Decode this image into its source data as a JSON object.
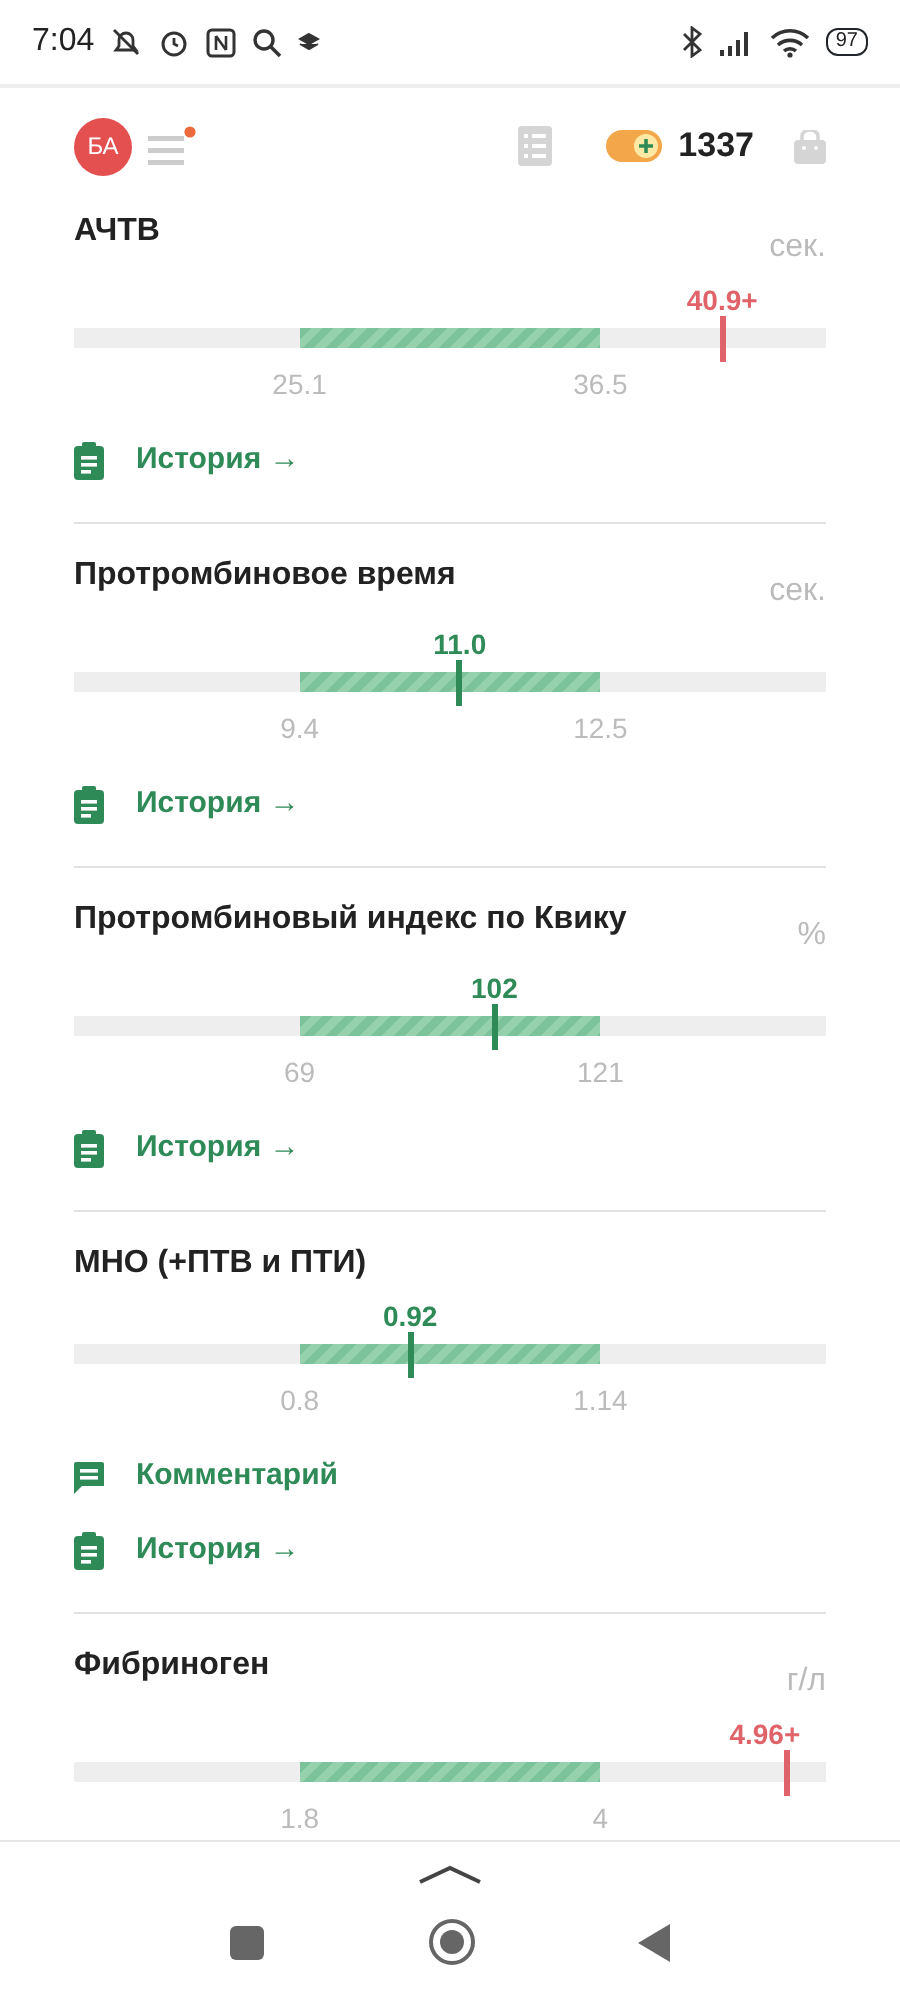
{
  "status_bar": {
    "time": "7:04",
    "battery": "97"
  },
  "header": {
    "avatar": "БА",
    "menu_notification": true,
    "points": "1337"
  },
  "tests": [
    {
      "name": "АЧТВ",
      "unit": "сек.",
      "range": {
        "low": "25.1",
        "high": "36.5"
      },
      "result": {
        "value": "40.9+",
        "level": 0.862,
        "color": "#e0636a"
      },
      "actions": [
        {
          "kind": "history",
          "label": "История →"
        }
      ]
    },
    {
      "name": "Протромбиновое время",
      "unit": "сек.",
      "range": {
        "low": "9.4",
        "high": "12.5"
      },
      "result": {
        "value": "11.0",
        "level": 0.513,
        "color": "#2e8a57"
      },
      "actions": [
        {
          "kind": "history",
          "label": "История →"
        }
      ]
    },
    {
      "name": "Протромбиновый индекс по Квику",
      "unit": "%",
      "range": {
        "low": "69",
        "high": "121"
      },
      "result": {
        "value": "102",
        "level": 0.559,
        "color": "#2e8a57"
      },
      "actions": [
        {
          "kind": "history",
          "label": "История →"
        }
      ]
    },
    {
      "name": "МНО (+ПТВ и ПТИ)",
      "range": {
        "low": "0.8",
        "high": "1.14"
      },
      "result": {
        "value": "0.92",
        "level": 0.447,
        "color": "#2e8a57"
      },
      "actions": [
        {
          "kind": "comment",
          "label": "Комментарий"
        },
        {
          "kind": "history",
          "label": "История →"
        }
      ]
    },
    {
      "name": "Фибриноген",
      "unit": "г/л",
      "range": {
        "low": "1.8",
        "high": "4"
      },
      "result": {
        "value": "4.96+",
        "level": 0.947,
        "color": "#e0636a"
      }
    }
  ]
}
